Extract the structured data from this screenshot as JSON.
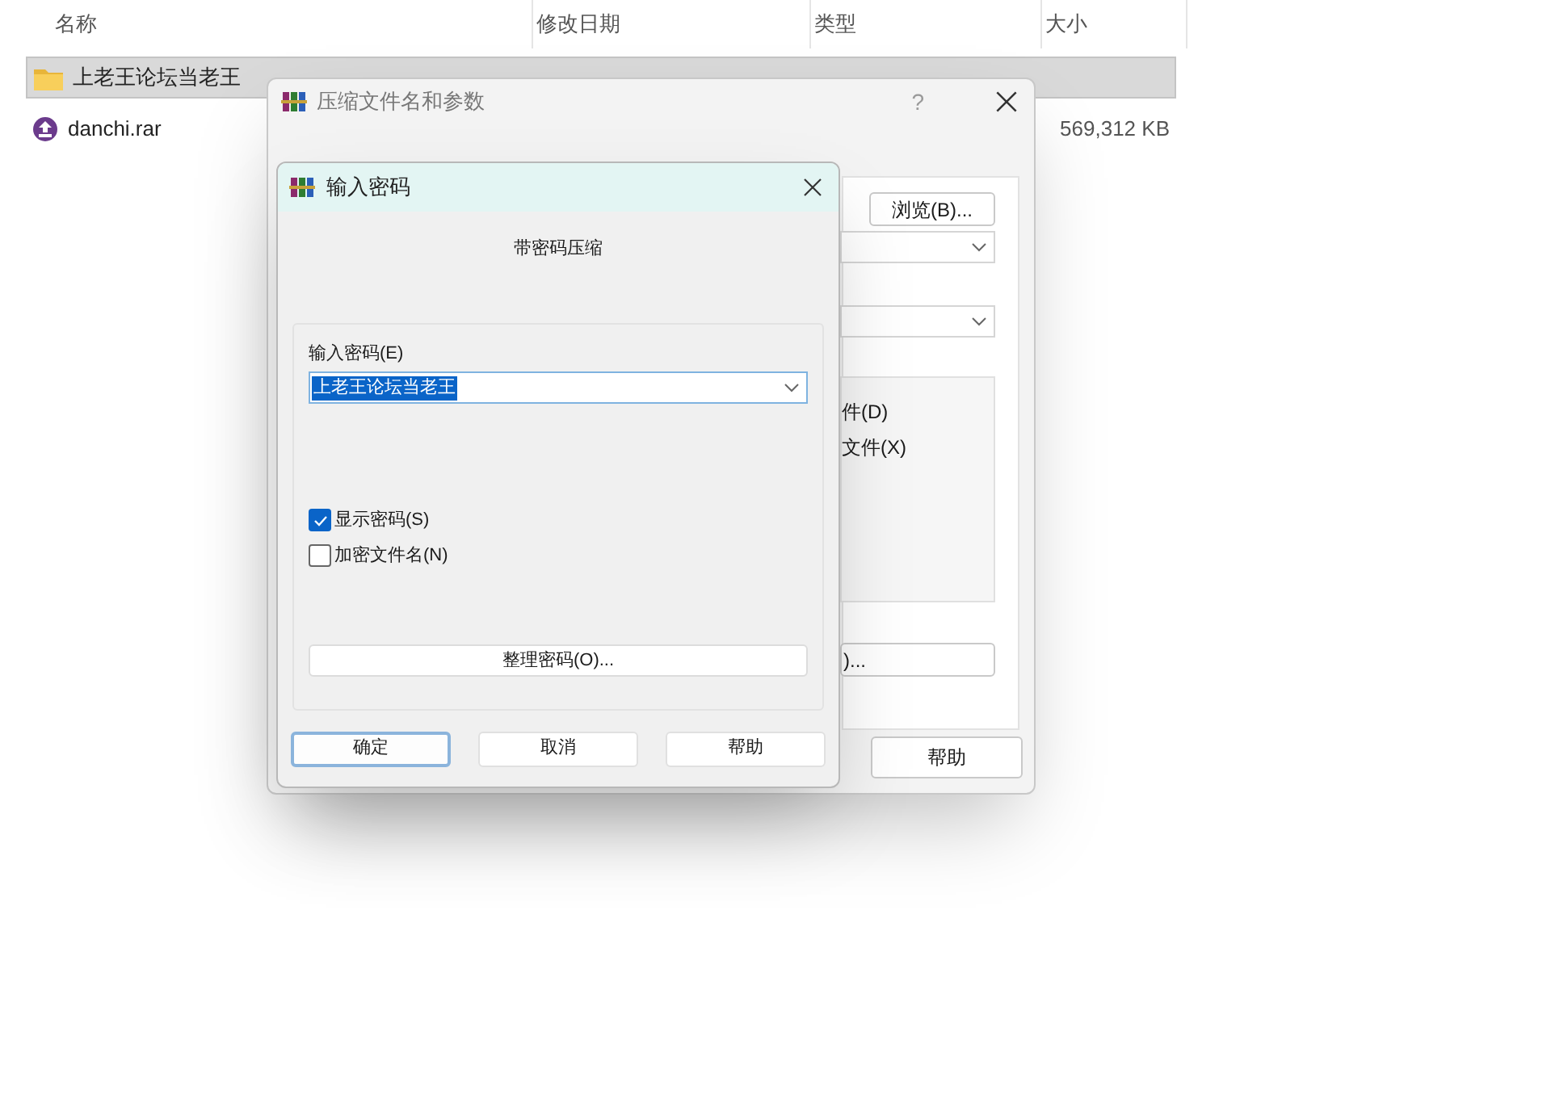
{
  "explorer": {
    "columns": [
      "名称",
      "修改日期",
      "类型",
      "大小"
    ],
    "files": [
      {
        "name": "上老王论坛当老王",
        "kind": "folder",
        "selected": true
      },
      {
        "name": "danchi.rar",
        "kind": "archive",
        "size": "569,312 KB",
        "selected": false
      }
    ]
  },
  "archive_dialog": {
    "title": "压缩文件名和参数",
    "help_glyph": "?",
    "browse_button": "浏览(B)...",
    "option_1": "件(D)",
    "option_2": "文件(X)",
    "side_button": ")...",
    "help_button": "帮助"
  },
  "password_dialog": {
    "title": "输入密码",
    "heading": "带密码压缩",
    "password_label": "输入密码(E)",
    "password_value": "上老王论坛当老王",
    "options": [
      {
        "label": "显示密码(S)",
        "checked": true
      },
      {
        "label": "加密文件名(N)",
        "checked": false
      }
    ],
    "organize_button": "整理密码(O)...",
    "buttons": [
      {
        "label": "确定",
        "focused": true
      },
      {
        "label": "取消",
        "focused": false
      },
      {
        "label": "帮助",
        "focused": false
      }
    ]
  }
}
